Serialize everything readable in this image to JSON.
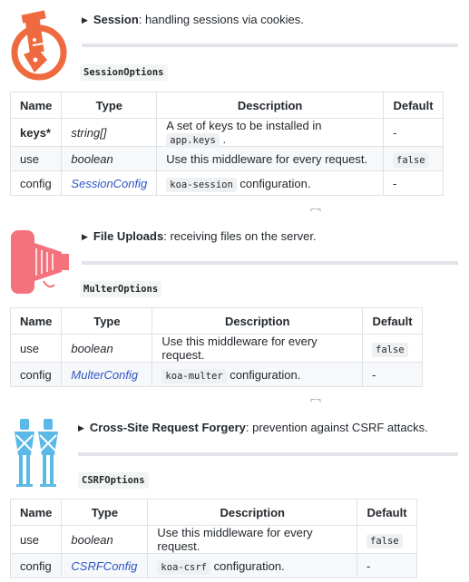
{
  "sections": [
    {
      "title": "Session",
      "summary": ": handling sessions via cookies.",
      "options_name": "SessionOptions",
      "columns": [
        "Name",
        "Type",
        "Description",
        "Default"
      ],
      "rows": [
        {
          "name": "keys*",
          "type": "string[]",
          "desc_pre": "A set of keys to be installed in ",
          "desc_code": "app.keys",
          "desc_post": " .",
          "default": "-"
        },
        {
          "name": "use",
          "type": "boolean",
          "desc_pre": "Use this middleware for every request.",
          "desc_code": "",
          "desc_post": "",
          "default": "false"
        },
        {
          "name": "config",
          "type": "SessionConfig",
          "desc_pre": "",
          "desc_code": "koa-session",
          "desc_post": " configuration.",
          "default": "-"
        }
      ]
    },
    {
      "title": "File Uploads",
      "summary": ": receiving files on the server.",
      "options_name": "MulterOptions",
      "columns": [
        "Name",
        "Type",
        "Description",
        "Default"
      ],
      "rows": [
        {
          "name": "use",
          "type": "boolean",
          "desc_pre": "Use this middleware for every request.",
          "desc_code": "",
          "desc_post": "",
          "default": "false"
        },
        {
          "name": "config",
          "type": "MulterConfig",
          "desc_pre": "",
          "desc_code": "koa-multer",
          "desc_post": " configuration.",
          "default": "-"
        }
      ]
    },
    {
      "title": "Cross-Site Request Forgery",
      "summary": ": prevention against CSRF attacks.",
      "options_name": "CSRFOptions",
      "columns": [
        "Name",
        "Type",
        "Description",
        "Default"
      ],
      "rows": [
        {
          "name": "use",
          "type": "boolean",
          "desc_pre": "Use this middleware for every request.",
          "desc_code": "",
          "desc_post": "",
          "default": "false"
        },
        {
          "name": "config",
          "type": "CSRFConfig",
          "desc_pre": "",
          "desc_code": "koa-csrf",
          "desc_post": " configuration.",
          "default": "-"
        }
      ]
    }
  ],
  "colors": {
    "session_illustration": "#ef6a3e",
    "uploads_illustration": "#f4727b",
    "csrf_illustration": "#5bb9e8",
    "link": "#2f54c5"
  },
  "icons": [
    "section-separator-icon"
  ]
}
